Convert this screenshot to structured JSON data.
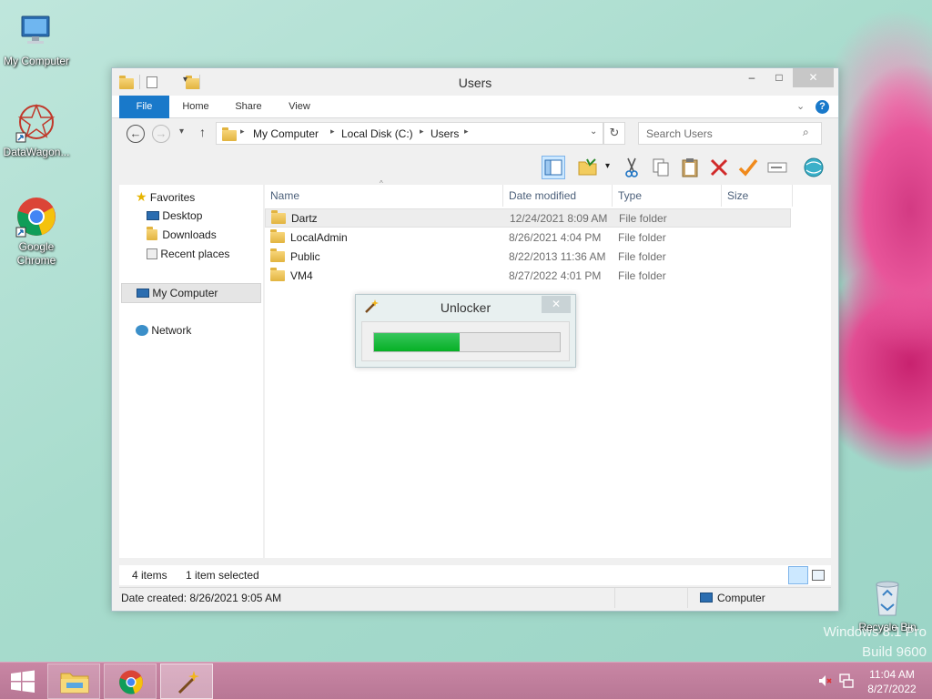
{
  "desktop": {
    "icons": [
      {
        "label": "My Computer"
      },
      {
        "label": "DataWagon..."
      },
      {
        "label": "Google Chrome"
      },
      {
        "label": "Recycle Bin"
      }
    ],
    "watermark_line1": "Windows 8.1 Pro",
    "watermark_line2": "Build 9600"
  },
  "explorer": {
    "title": "Users",
    "controls": {
      "minimize": "–",
      "maximize": "□",
      "close": "✕"
    },
    "ribbon_tabs": [
      "File",
      "Home",
      "Share",
      "View"
    ],
    "breadcrumb": [
      "My Computer",
      "Local Disk (C:)",
      "Users"
    ],
    "search_placeholder": "Search Users",
    "nav": {
      "favorites": "Favorites",
      "desktop": "Desktop",
      "downloads": "Downloads",
      "recent": "Recent places",
      "computer": "My Computer",
      "network": "Network"
    },
    "columns": [
      "Name",
      "Date modified",
      "Type",
      "Size"
    ],
    "rows": [
      {
        "name": "Dartz",
        "date": "12/24/2021 8:09 AM",
        "type": "File folder"
      },
      {
        "name": "LocalAdmin",
        "date": "8/26/2021 4:04 PM",
        "type": "File folder"
      },
      {
        "name": "Public",
        "date": "8/22/2013 11:36 AM",
        "type": "File folder"
      },
      {
        "name": "VM4",
        "date": "8/27/2022 4:01 PM",
        "type": "File folder"
      }
    ],
    "status": {
      "items": "4 items",
      "selected": "1 item selected",
      "date_created": "Date created: 8/26/2021 9:05 AM",
      "location": "Computer"
    }
  },
  "unlocker": {
    "title": "Unlocker",
    "close": "✕",
    "progress": 0.46
  },
  "taskbar": {
    "time": "11:04 AM",
    "date": "8/27/2022"
  },
  "colors": {
    "accent": "#1979ca",
    "progress": "#22b14c",
    "close_hover": "#c75050",
    "taskbar": "#c17f9e"
  }
}
